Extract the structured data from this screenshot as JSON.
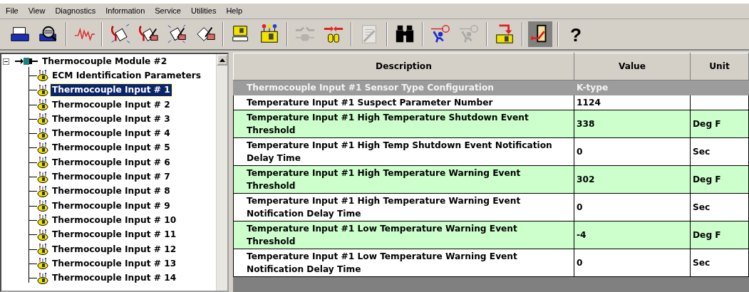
{
  "menu": [
    "File",
    "View",
    "Diagnostics",
    "Information",
    "Service",
    "Utilities",
    "Help"
  ],
  "toolbar": [
    {
      "kind": "printer",
      "disabled": false,
      "pressed": false
    },
    {
      "kind": "preview",
      "disabled": false,
      "pressed": false
    },
    {
      "kind": "separator"
    },
    {
      "kind": "waveform",
      "disabled": false,
      "pressed": false
    },
    {
      "kind": "separator"
    },
    {
      "kind": "stethoscope",
      "disabled": false,
      "pressed": false
    },
    {
      "kind": "stethopen",
      "disabled": false,
      "pressed": false
    },
    {
      "kind": "sparkpen",
      "disabled": false,
      "pressed": false
    },
    {
      "kind": "docpen",
      "disabled": false,
      "pressed": false
    },
    {
      "kind": "separator"
    },
    {
      "kind": "modules",
      "disabled": false,
      "pressed": false
    },
    {
      "kind": "module",
      "disabled": false,
      "pressed": false
    },
    {
      "kind": "separator"
    },
    {
      "kind": "connect",
      "disabled": true,
      "pressed": false
    },
    {
      "kind": "disconnect",
      "disabled": false,
      "pressed": false
    },
    {
      "kind": "separator"
    },
    {
      "kind": "docwrench",
      "disabled": true,
      "pressed": false
    },
    {
      "kind": "separator"
    },
    {
      "kind": "binoculars",
      "disabled": false,
      "pressed": false
    },
    {
      "kind": "separator"
    },
    {
      "kind": "figure",
      "disabled": false,
      "pressed": false
    },
    {
      "kind": "figure",
      "disabled": true,
      "pressed": false
    },
    {
      "kind": "separator"
    },
    {
      "kind": "moduleArrow",
      "disabled": false,
      "pressed": false
    },
    {
      "kind": "separator"
    },
    {
      "kind": "exit",
      "disabled": false,
      "pressed": true
    },
    {
      "kind": "separator"
    },
    {
      "kind": "help",
      "disabled": false,
      "pressed": false,
      "label": "?"
    }
  ],
  "tree": {
    "label": "Thermocouple Module #2",
    "expanded": true,
    "children": [
      {
        "label": "ECM Identification Parameters",
        "selected": false
      },
      {
        "label": "Thermocouple Input # 1",
        "selected": true
      },
      {
        "label": "Thermocouple Input # 2",
        "selected": false
      },
      {
        "label": "Thermocouple Input # 3",
        "selected": false
      },
      {
        "label": "Thermocouple Input # 4",
        "selected": false
      },
      {
        "label": "Thermocouple Input # 5",
        "selected": false
      },
      {
        "label": "Thermocouple Input # 6",
        "selected": false
      },
      {
        "label": "Thermocouple Input # 7",
        "selected": false
      },
      {
        "label": "Thermocouple Input # 8",
        "selected": false
      },
      {
        "label": "Thermocouple Input # 9",
        "selected": false
      },
      {
        "label": "Thermocouple Input # 10",
        "selected": false
      },
      {
        "label": "Thermocouple Input # 11",
        "selected": false
      },
      {
        "label": "Thermocouple Input # 12",
        "selected": false
      },
      {
        "label": "Thermocouple Input # 13",
        "selected": false
      },
      {
        "label": "Thermocouple Input # 14",
        "selected": false
      }
    ]
  },
  "table": {
    "columns": [
      "Description",
      "Value",
      "Unit"
    ],
    "rows": [
      {
        "description": "Thermocouple Input #1 Sensor Type Configuration",
        "value": "K-type",
        "selected": true
      },
      {
        "description": "Temperature Input #1 Suspect Parameter Number",
        "value": "1124",
        "selected": false,
        "editable": false
      },
      {
        "description": "Temperature Input #1 High Temperature Shutdown Event Threshold",
        "value": "338",
        "unit": "Deg F",
        "selected": false,
        "editable": true
      },
      {
        "description": "Temperature Input #1 High Temp Shutdown Event Notification Delay Time",
        "value": "0",
        "unit": "Sec",
        "selected": false,
        "editable": false
      },
      {
        "description": "Temperature Input #1 High Temperature Warning Event Threshold",
        "value": "302",
        "unit": "Deg F",
        "selected": false,
        "editable": true
      },
      {
        "description": "Temperature Input #1 High Temperature Warning Event Notification Delay Time",
        "value": "0",
        "unit": "Sec",
        "selected": false,
        "editable": false
      },
      {
        "description": "Temperature Input #1 Low Temperature Warning Event Threshold",
        "value": "-4",
        "unit": "Deg F",
        "selected": false,
        "editable": true
      },
      {
        "description": "Temperature Input #1 Low Temperature Warning Event Notification Delay Time",
        "value": "0",
        "unit": "Sec",
        "selected": false,
        "editable": false
      }
    ]
  }
}
